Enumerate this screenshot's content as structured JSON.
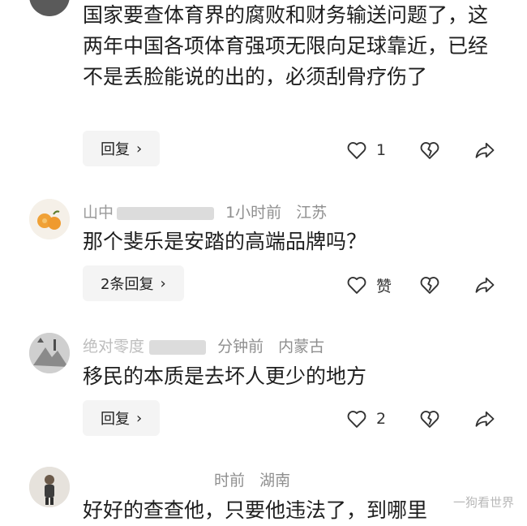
{
  "comments": [
    {
      "text": "国家要查体育界的腐败和财务输送问题了，这两年中国各项体育强项无限向足球靠近，已经不是丢脸能说的出的，必须刮骨疗伤了",
      "reply_label": "回复",
      "like_count": "1"
    },
    {
      "name": "山中",
      "time": "1小时前",
      "location": "江苏",
      "text": "那个斐乐是安踏的高端品牌吗？",
      "reply_label": "2条回复",
      "like_count": "赞"
    },
    {
      "name": "绝对零度",
      "time": "分钟前",
      "location": "内蒙古",
      "text": "移民的本质是去坏人更少的地方",
      "reply_label": "回复",
      "like_count": "2"
    },
    {
      "time": "时前",
      "location": "湖南",
      "text": "好好的查查他，只要他违法了，到哪里"
    }
  ],
  "watermark": "一狗看世界",
  "icons": {
    "like": "heart-icon",
    "dislike": "broken-heart-icon",
    "share": "share-arrow-icon",
    "chevron": "chevron-right-icon"
  },
  "colors": {
    "meta_text": "#8f8f8f",
    "button_bg": "#f4f4f4",
    "body_text": "#1e1e1e"
  }
}
